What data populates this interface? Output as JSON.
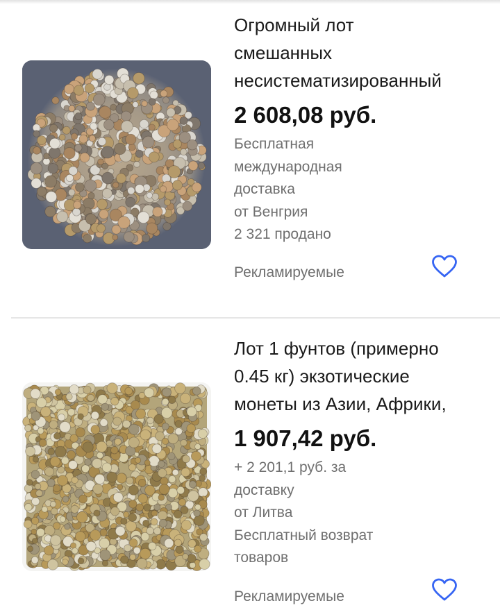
{
  "listings": [
    {
      "title": "Огромный лот\nсмешанных\nнесистематизированный",
      "price": "2 608,08 руб.",
      "details": [
        "Бесплатная",
        "международная",
        "доставка",
        "от Венгрия",
        "2 321 продано"
      ],
      "sponsored": "Рекламируемые",
      "image": "coin-pile-image",
      "accent": "#3665f3"
    },
    {
      "title": "Лот 1 фунтов (примерно\n0.45 кг) экзотические\nмонеты из Азии, Африки,",
      "price": "1 907,42 руб.",
      "details": [
        "+ 2 201,1 руб. за",
        "доставку",
        "от Литва",
        "Бесплатный возврат",
        "товаров"
      ],
      "sponsored": "Рекламируемые",
      "image": "coin-pile-image",
      "accent": "#3665f3"
    }
  ],
  "icons": {
    "favorite": "heart-icon"
  }
}
